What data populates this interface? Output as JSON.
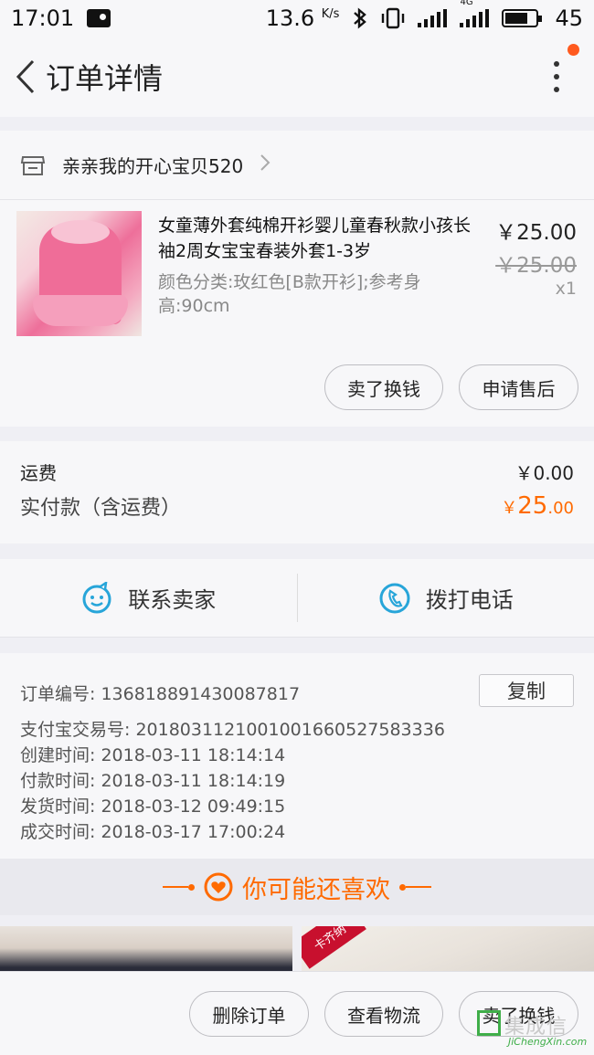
{
  "status_bar": {
    "time": "17:01",
    "speed": "13.6",
    "speed_unit": "K/s",
    "network": "4G",
    "battery": "45"
  },
  "nav": {
    "title": "订单详情"
  },
  "shop": {
    "name": "亲亲我的开心宝贝520"
  },
  "item": {
    "title": "女童薄外套纯棉开衫婴儿童春秋款小孩长袖2周女宝宝春装外套1-3岁",
    "sku": "颜色分类:玫红色[B款开衫];参考身高:90cm",
    "price": "￥25.00",
    "original_price": "￥25.00",
    "quantity": "x1",
    "actions": [
      "卖了换钱",
      "申请售后"
    ]
  },
  "fees": {
    "shipping_label": "运费",
    "shipping_value": "￥0.00",
    "paid_label": "实付款（含运费）",
    "paid_currency": "￥",
    "paid_integer": "25",
    "paid_decimal": ".00"
  },
  "contact": {
    "seller": "联系卖家",
    "call": "拨打电话"
  },
  "order_info": {
    "copy_label": "复制",
    "rows": [
      "订单编号:  136818891430087817",
      "支付宝交易号:  2018031121001001660527583336",
      "创建时间:  2018-03-11 18:14:14",
      "付款时间:  2018-03-11 18:14:19",
      "发货时间:  2018-03-12 09:49:15",
      "成交时间:  2018-03-17 17:00:24"
    ]
  },
  "recommend": {
    "title": "你可能还喜欢",
    "tag": "卡齐纳"
  },
  "bottom_bar": {
    "buttons": [
      "删除订单",
      "查看物流",
      "卖了换钱"
    ]
  },
  "watermark": {
    "cn": "集成信",
    "en": "JiChengXin.com"
  },
  "colors": {
    "accent": "#ff6a00",
    "notify_dot": "#ff5a1f",
    "contact_icon": "#27a5d9"
  }
}
